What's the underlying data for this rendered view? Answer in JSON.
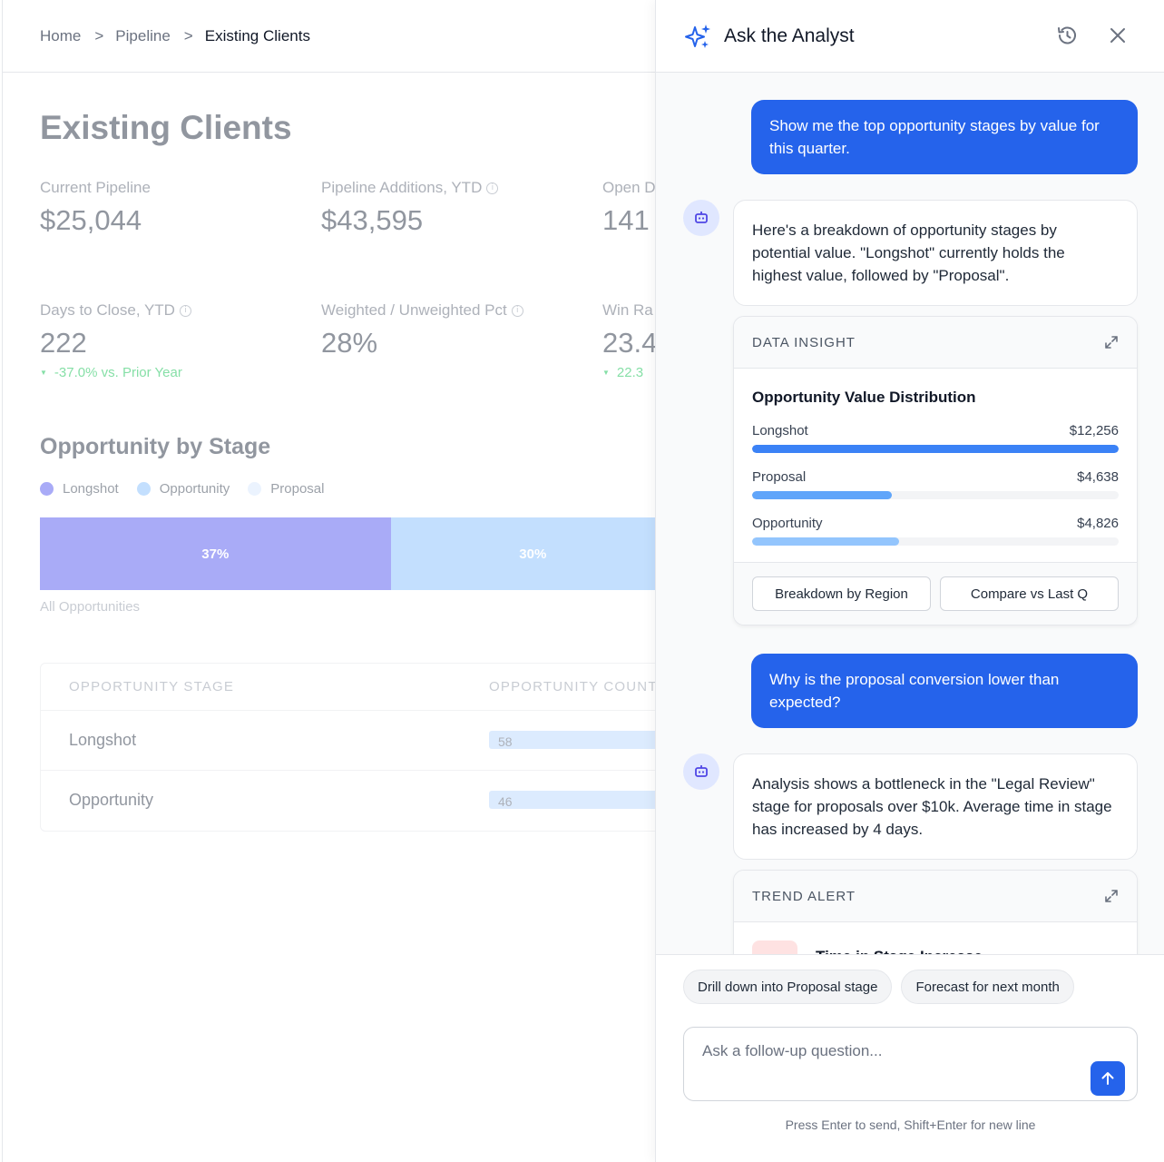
{
  "breadcrumb": [
    "Home",
    "Pipeline",
    "Existing Clients"
  ],
  "breadcrumb_sep": ">",
  "dashboard": {
    "title": "Existing Clients",
    "metrics": [
      {
        "label": "Current Pipeline",
        "value": "$25,044"
      },
      {
        "label": "Pipeline Additions, YTD",
        "value": "$43,595"
      },
      {
        "label": "Open D",
        "value": "141"
      },
      {
        "label": "Days to Close, YTD",
        "value": "222",
        "delta": "-37.0% vs. Prior Year"
      },
      {
        "label": "Weighted / Unweighted Pct",
        "value": "28%"
      },
      {
        "label": "Win Ra",
        "value": "23.4",
        "delta": "22.3"
      }
    ],
    "section_title": "Opportunity by Stage",
    "legend": [
      {
        "label": "Longshot",
        "color": "#a5b4fc"
      },
      {
        "label": "Opportunity",
        "color": "#bfdbfe"
      },
      {
        "label": "Proposal",
        "color": "#dbeafe"
      }
    ],
    "stacked": [
      {
        "label": "37%",
        "pct": 37,
        "color": "#6366f1"
      },
      {
        "label": "30%",
        "pct": 30,
        "color": "#93c5fd"
      }
    ],
    "stack_caption": "All Opportunities",
    "table": {
      "headers": [
        "OPPORTUNITY STAGE",
        "OPPORTUNITY COUNT"
      ],
      "rows": [
        {
          "stage": "Longshot",
          "count": "58"
        },
        {
          "stage": "Opportunity",
          "count": "46"
        }
      ]
    }
  },
  "panel": {
    "title": "Ask the Analyst",
    "messages": {
      "user1": "Show me the top opportunity stages by value for this quarter.",
      "bot1": "Here's a breakdown of opportunity stages by potential value. \"Longshot\" currently holds the highest value, followed by \"Proposal\".",
      "user2": "Why is the proposal conversion lower than expected?",
      "bot2": "Analysis shows a bottleneck in the \"Legal Review\" stage for proposals over $10k. Average time in stage has increased by 4 days."
    },
    "insight_card": {
      "header": "DATA INSIGHT",
      "title": "Opportunity Value Distribution",
      "rows": [
        {
          "label": "Longshot",
          "value": "$12,256",
          "fraction": 1.0,
          "color": "#3b82f6"
        },
        {
          "label": "Proposal",
          "value": "$4,638",
          "fraction": 0.38,
          "color": "#60a5fa"
        },
        {
          "label": "Opportunity",
          "value": "$4,826",
          "fraction": 0.4,
          "color": "#93c5fd"
        }
      ],
      "actions": [
        "Breakdown by Region",
        "Compare vs Last Q"
      ]
    },
    "trend_card": {
      "header": "TREND ALERT",
      "title": "Time in Stage Increase"
    },
    "suggestions": [
      "Drill down into Proposal stage",
      "Forecast for next month"
    ],
    "input_placeholder": "Ask a follow-up question...",
    "hint": "Press Enter to send, Shift+Enter for new line"
  }
}
